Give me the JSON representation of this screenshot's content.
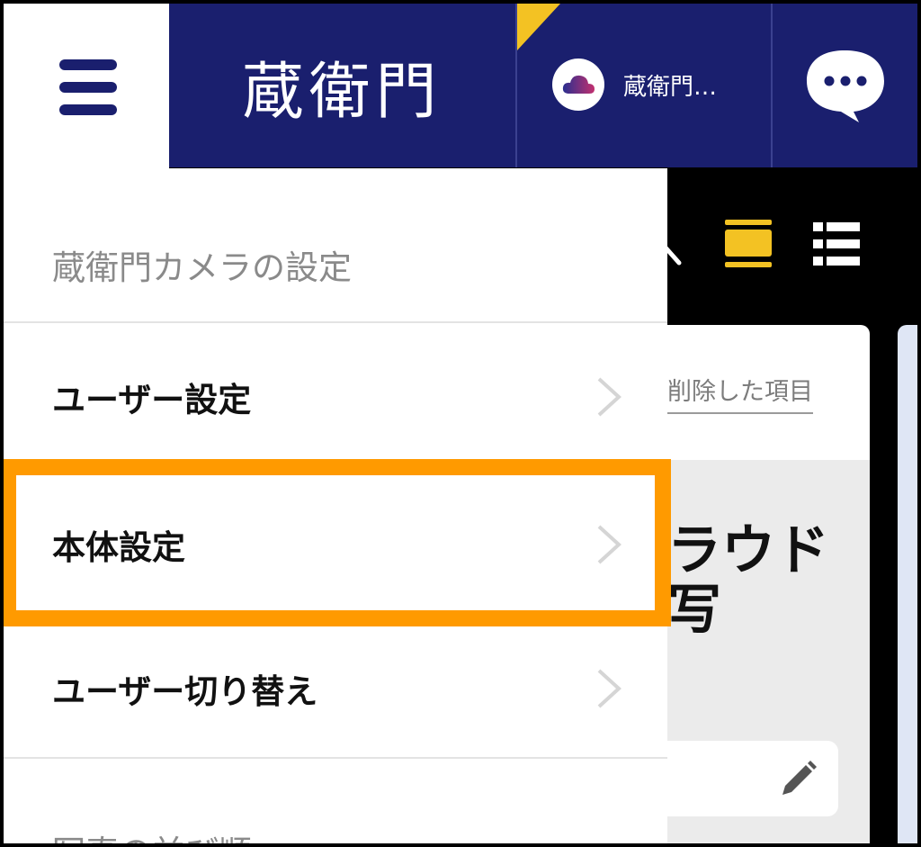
{
  "header": {
    "logo_text": "蔵衛門",
    "account_name": "蔵衛門…",
    "icons": [
      "hamburger-icon",
      "cloud-avatar-icon",
      "chat-bubble-icon"
    ]
  },
  "toolbar": {
    "icons": [
      "search-icon",
      "grid-view-icon",
      "list-view-icon"
    ],
    "active_view_color": "#f3c223"
  },
  "drawer": {
    "heading": "蔵衛門カメラの設定",
    "items": [
      {
        "label": "ユーザー設定"
      },
      {
        "label": "本体設定"
      },
      {
        "label": "ユーザー切り替え"
      }
    ],
    "next_section_fragment": "写真の並び順"
  },
  "background": {
    "deleted_link": "削除した項目",
    "title_line1": "ラウド",
    "title_line2": "写"
  },
  "colors": {
    "header_bg": "#1a1f6e",
    "highlight": "#ff9a00",
    "accent_yellow": "#f3c223"
  }
}
